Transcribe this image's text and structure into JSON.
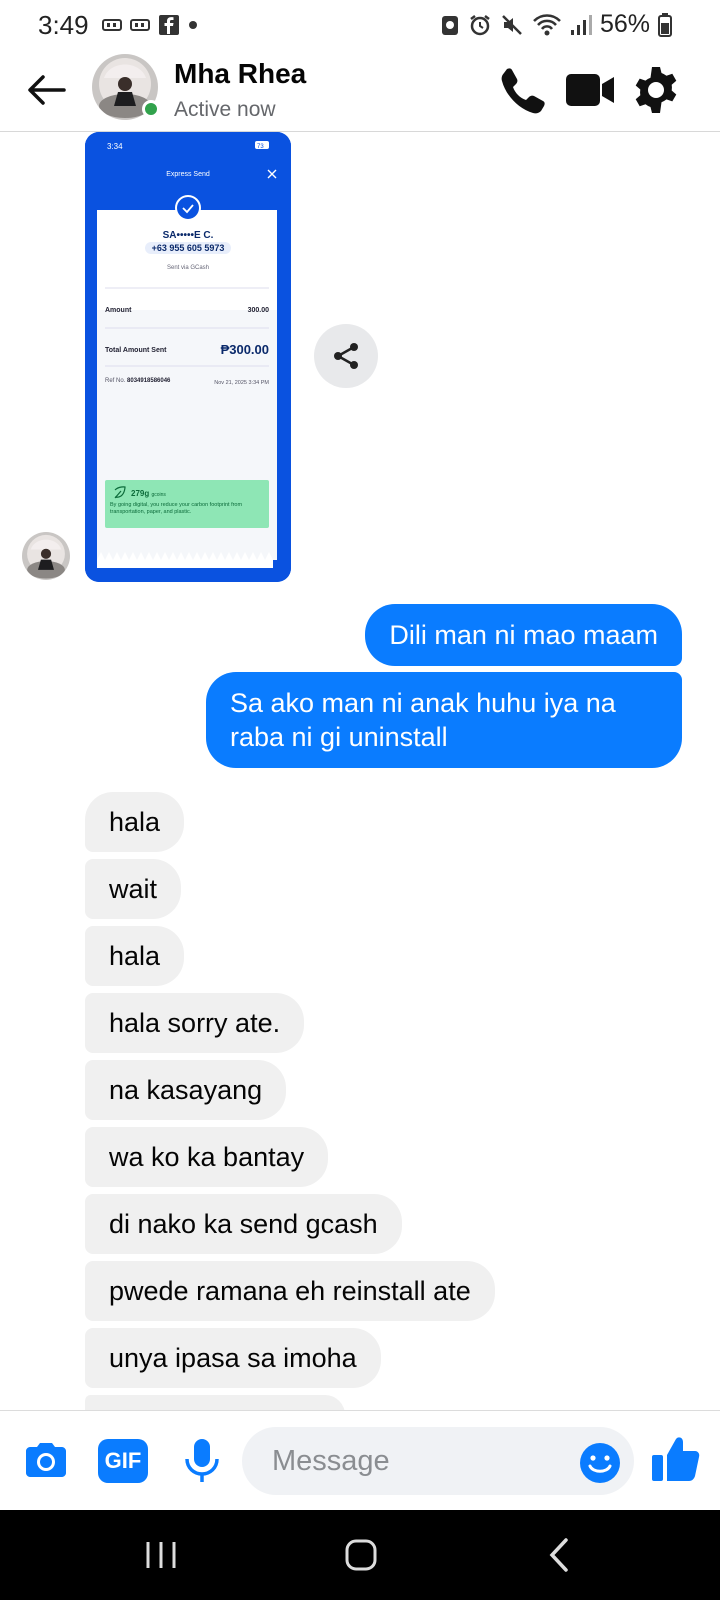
{
  "status_bar": {
    "time": "3:49",
    "battery_percent": "56%",
    "icons": [
      "notification-icon",
      "notification-icon",
      "facebook-icon",
      "dot-icon",
      "nfc-icon",
      "alarm-icon",
      "mute-icon",
      "wifi-icon",
      "signal-icon",
      "battery-icon"
    ]
  },
  "header": {
    "contact_name": "Mha Rhea",
    "status": "Active now",
    "accent_color": "#0a7cff",
    "online_color": "#31a24c"
  },
  "shared_image": {
    "time": "3:34",
    "battery": "73",
    "title": "Express Send",
    "recipient": "SA•••••E C.",
    "phone": "+63 955 605 5973",
    "via": "Sent via GCash",
    "amount_label": "Amount",
    "amount_value": "300.00",
    "total_label": "Total Amount Sent",
    "total_value": "₱300.00",
    "ref_label": "Ref No.",
    "ref_no": "8034918586046",
    "date": "Nov 21, 2025 3:34 PM",
    "green_amount": "279g",
    "green_unit": "gcoins",
    "green_note": "By going digital, you reduce your carbon footprint from transportation, paper, and plastic."
  },
  "messages_out": [
    "Dili man ni mao maam",
    "Sa ako man ni anak huhu iya na raba ni gi uninstall"
  ],
  "messages_in": [
    "hala",
    "wait",
    "hala",
    "hala sorry ate.",
    "na kasayang",
    "wa ko ka bantay",
    "di nako ka send gcash",
    "pwede ramana eh reinstall ate",
    "unya ipasa sa imoha"
  ],
  "composer": {
    "placeholder": "Message",
    "gif_label": "GIF"
  }
}
